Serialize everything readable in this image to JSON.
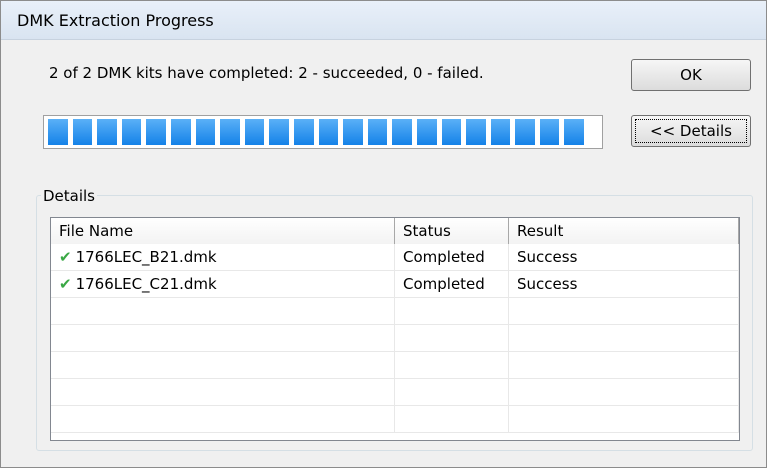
{
  "window": {
    "title": "DMK Extraction Progress"
  },
  "summary": "2 of 2 DMK kits have completed: 2 - succeeded, 0 - failed.",
  "buttons": {
    "ok_label": "OK",
    "details_label": "<< Details"
  },
  "progress": {
    "fraction": 1.0,
    "segments": 22,
    "color": "#1e8fef"
  },
  "details": {
    "group_label": "Details",
    "columns": [
      "File Name",
      "Status",
      "Result"
    ],
    "rows": [
      {
        "icon": "check-icon",
        "file": "1766LEC_B21.dmk",
        "status": "Completed",
        "result": "Success"
      },
      {
        "icon": "check-icon",
        "file": "1766LEC_C21.dmk",
        "status": "Completed",
        "result": "Success"
      }
    ],
    "empty_rows": 5
  },
  "colors": {
    "check": "#3aa845"
  }
}
